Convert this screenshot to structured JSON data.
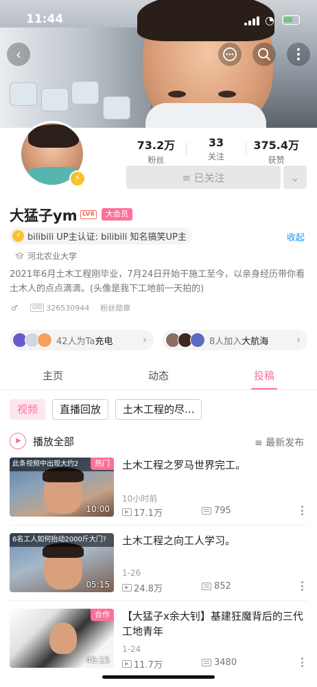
{
  "status_bar": {
    "time": "11:44"
  },
  "profile": {
    "name": "大猛子ym",
    "level": "LV6",
    "vip_badge": "大会员",
    "stats": [
      {
        "value": "73.2万",
        "label": "粉丝"
      },
      {
        "value": "33",
        "label": "关注"
      },
      {
        "value": "375.4万",
        "label": "获赞"
      }
    ],
    "follow_label": "≡ 已关注",
    "certification": "bilibili UP主认证: bilibili 知名搞笑UP主",
    "collapse_label": "收起",
    "school": "河北农业大学",
    "bio": "2021年6月土木工程刚毕业，7月24日开始干施工至今，以亲身经历带你看土木人的点点滴滴。(头像是我下工地前一天拍的)",
    "gender_symbol": "♂",
    "uid_tag": "UID",
    "uid": "326530944",
    "fan_medal": "粉丝勋章",
    "charge": {
      "text": "42人为Ta",
      "highlight": "充电"
    },
    "fleet": {
      "text": "8人加入",
      "highlight": "大航海"
    }
  },
  "tabs": [
    {
      "label": "主页",
      "active": false
    },
    {
      "label": "动态",
      "active": false
    },
    {
      "label": "投稿",
      "active": true
    }
  ],
  "filters": [
    "视频",
    "直播回放",
    "土木工程的尽..."
  ],
  "list_header": {
    "play_all": "播放全部",
    "sort": "≡ 最新发布"
  },
  "videos": [
    {
      "thumb_text": "此条视频中出现大约2",
      "badge": "热门",
      "duration": "10:00",
      "title": "土木工程之罗马世界完工。",
      "date": "10小时前",
      "views": "17.1万",
      "danmaku": "795"
    },
    {
      "thumb_text": "6名工人如何抬动2000斤大门?",
      "badge": "",
      "duration": "05:15",
      "title": "土木工程之向工人学习。",
      "date": "1-26",
      "views": "24.8万",
      "danmaku": "852"
    },
    {
      "thumb_text": "",
      "badge": "合作",
      "duration": "45:15",
      "title": "【大猛子x余大钊】基建狂魔背后的三代工地青年",
      "date": "1-24",
      "views": "11.7万",
      "danmaku": "3480"
    }
  ],
  "colors": {
    "accent": "#fb7299",
    "link": "#2196f3"
  }
}
